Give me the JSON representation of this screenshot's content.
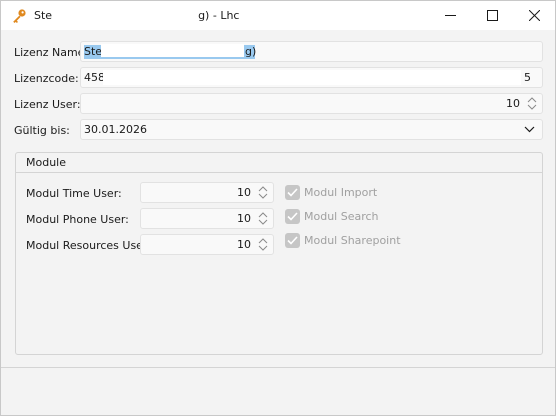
{
  "window": {
    "title_prefix": "Ste",
    "title_suffix": "g) - Lhc",
    "icon": "key-icon",
    "controls": [
      "minimize-icon",
      "maximize-icon",
      "close-icon"
    ]
  },
  "form": {
    "lizenz_name": {
      "label": "Lizenz Name:",
      "value_prefix": "Ste",
      "value_suffix": "g)"
    },
    "lizenzcode": {
      "label": "Lizenzcode:",
      "value_prefix": "458",
      "value_suffix": "5"
    },
    "lizenz_user": {
      "label": "Lizenz User:",
      "value": "10"
    },
    "gueltig_bis": {
      "label": "Gültig bis:",
      "value": "30.01.2026"
    }
  },
  "module": {
    "title": "Module",
    "rows": [
      {
        "label": "Modul Time User:",
        "value": "10"
      },
      {
        "label": "Modul Phone User:",
        "value": "10"
      },
      {
        "label": "Modul Resources User:",
        "value": "10"
      }
    ],
    "checkboxes": [
      {
        "label": "Modul Import",
        "checked": true,
        "enabled": false
      },
      {
        "label": "Modul Search",
        "checked": true,
        "enabled": false
      },
      {
        "label": "Modul Sharepoint",
        "checked": true,
        "enabled": false
      }
    ]
  },
  "colors": {
    "selection": "#99c9ef",
    "title_icon": "#e0891f"
  }
}
